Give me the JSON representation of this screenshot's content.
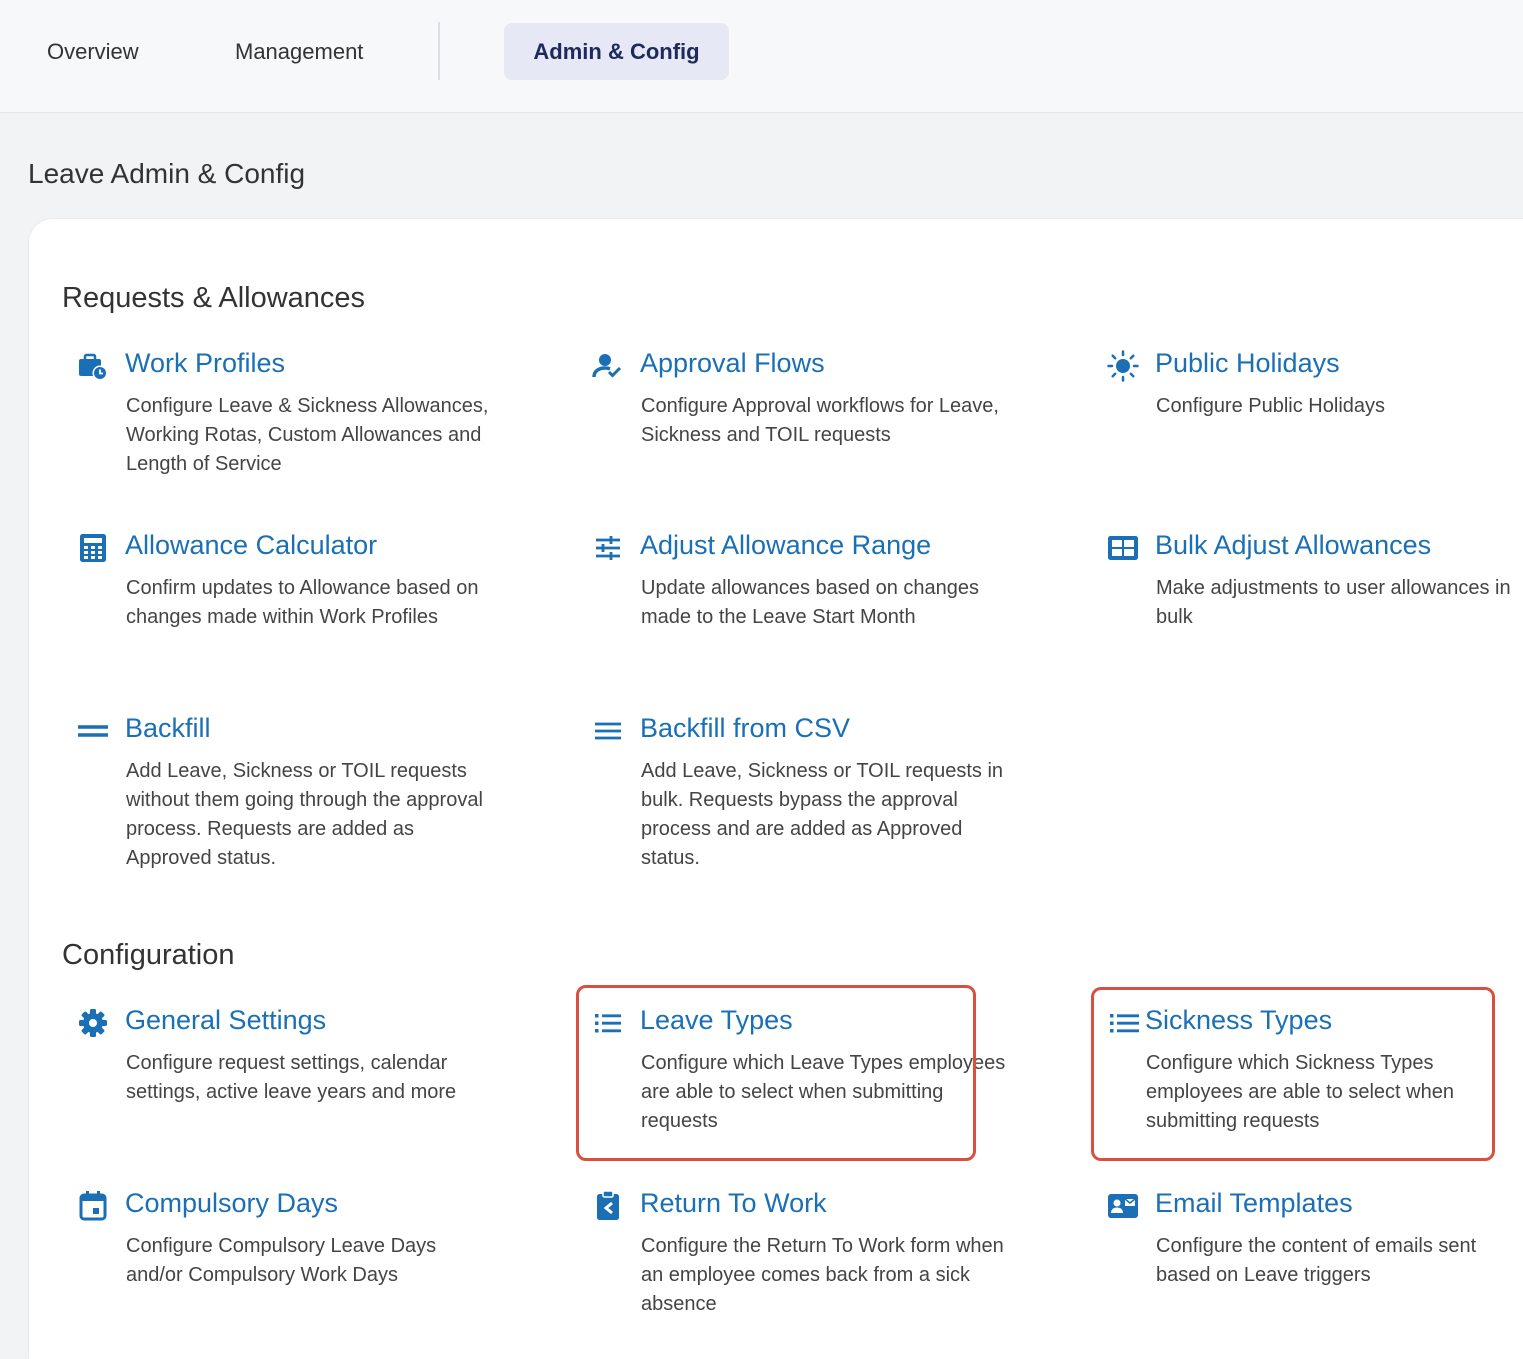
{
  "nav": {
    "tabs": [
      {
        "label": "Overview"
      },
      {
        "label": "Management"
      },
      {
        "label": "Admin & Config",
        "active": true
      }
    ]
  },
  "page": {
    "title": "Leave Admin & Config"
  },
  "sections": {
    "requests": {
      "title": "Requests & Allowances",
      "items": [
        {
          "icon": "briefcase-clock-icon",
          "title": "Work Profiles",
          "desc": "Configure Leave & Sickness Allowances, Working Rotas, Custom Allowances and Length of Service"
        },
        {
          "icon": "user-check-icon",
          "title": "Approval Flows",
          "desc": "Configure Approval workflows for Leave, Sickness and TOIL requests"
        },
        {
          "icon": "sun-icon",
          "title": "Public Holidays",
          "desc": "Configure Public Holidays"
        },
        {
          "icon": "calculator-icon",
          "title": "Allowance Calculator",
          "desc": "Confirm updates to Allowance based on changes made within Work Profiles"
        },
        {
          "icon": "sliders-icon",
          "title": "Adjust Allowance Range",
          "desc": "Update allowances based on changes made to the Leave Start Month"
        },
        {
          "icon": "grid-icon",
          "title": "Bulk Adjust Allowances",
          "desc": "Make adjustments to user allowances in bulk"
        },
        {
          "icon": "equals-icon",
          "title": "Backfill",
          "desc": "Add Leave, Sickness or TOIL requests without them going through the approval process. Requests are added as Approved status."
        },
        {
          "icon": "menu-lines-icon",
          "title": "Backfill from CSV",
          "desc": "Add Leave, Sickness or TOIL requests in bulk. Requests bypass the approval process and are added as Approved status."
        }
      ]
    },
    "configuration": {
      "title": "Configuration",
      "items": [
        {
          "icon": "gear-icon",
          "title": "General Settings",
          "desc": "Configure request settings, calendar settings, active leave years and more"
        },
        {
          "icon": "list-icon",
          "title": "Leave Types",
          "desc": "Configure which Leave Types employees are able to select when submitting requests"
        },
        {
          "icon": "list-icon",
          "title": "Sickness Types",
          "desc": "Configure which Sickness Types employees are able to select when submitting requests"
        },
        {
          "icon": "calendar-icon",
          "title": "Compulsory Days",
          "desc": "Configure Compulsory Leave Days and/or Compulsory Work Days"
        },
        {
          "icon": "clipboard-return-icon",
          "title": "Return To Work",
          "desc": "Configure the Return To Work form when an employee comes back from a sick absence"
        },
        {
          "icon": "contact-card-icon",
          "title": "Email Templates",
          "desc": "Configure the content of emails sent based on Leave triggers"
        }
      ]
    }
  },
  "colors": {
    "link": "#1a6fb5",
    "icon": "#1a6fb5",
    "highlight": "#d9503f",
    "active_tab_bg": "#e6e9f5"
  }
}
